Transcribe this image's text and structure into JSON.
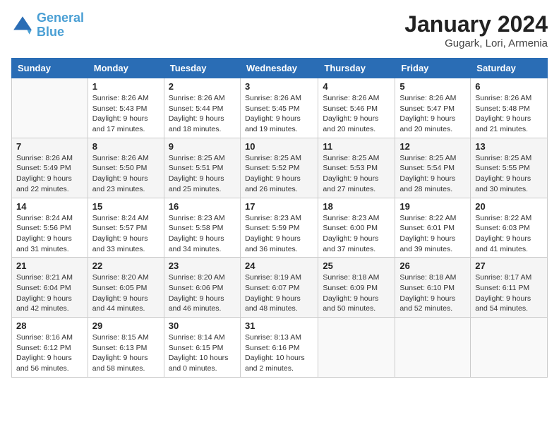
{
  "header": {
    "logo_general": "General",
    "logo_blue": "Blue",
    "month_year": "January 2024",
    "location": "Gugark, Lori, Armenia"
  },
  "days_of_week": [
    "Sunday",
    "Monday",
    "Tuesday",
    "Wednesday",
    "Thursday",
    "Friday",
    "Saturday"
  ],
  "weeks": [
    [
      {
        "day": "",
        "sunrise": "",
        "sunset": "",
        "daylight": ""
      },
      {
        "day": "1",
        "sunrise": "Sunrise: 8:26 AM",
        "sunset": "Sunset: 5:43 PM",
        "daylight": "Daylight: 9 hours and 17 minutes."
      },
      {
        "day": "2",
        "sunrise": "Sunrise: 8:26 AM",
        "sunset": "Sunset: 5:44 PM",
        "daylight": "Daylight: 9 hours and 18 minutes."
      },
      {
        "day": "3",
        "sunrise": "Sunrise: 8:26 AM",
        "sunset": "Sunset: 5:45 PM",
        "daylight": "Daylight: 9 hours and 19 minutes."
      },
      {
        "day": "4",
        "sunrise": "Sunrise: 8:26 AM",
        "sunset": "Sunset: 5:46 PM",
        "daylight": "Daylight: 9 hours and 20 minutes."
      },
      {
        "day": "5",
        "sunrise": "Sunrise: 8:26 AM",
        "sunset": "Sunset: 5:47 PM",
        "daylight": "Daylight: 9 hours and 20 minutes."
      },
      {
        "day": "6",
        "sunrise": "Sunrise: 8:26 AM",
        "sunset": "Sunset: 5:48 PM",
        "daylight": "Daylight: 9 hours and 21 minutes."
      }
    ],
    [
      {
        "day": "7",
        "sunrise": "Sunrise: 8:26 AM",
        "sunset": "Sunset: 5:49 PM",
        "daylight": "Daylight: 9 hours and 22 minutes."
      },
      {
        "day": "8",
        "sunrise": "Sunrise: 8:26 AM",
        "sunset": "Sunset: 5:50 PM",
        "daylight": "Daylight: 9 hours and 23 minutes."
      },
      {
        "day": "9",
        "sunrise": "Sunrise: 8:25 AM",
        "sunset": "Sunset: 5:51 PM",
        "daylight": "Daylight: 9 hours and 25 minutes."
      },
      {
        "day": "10",
        "sunrise": "Sunrise: 8:25 AM",
        "sunset": "Sunset: 5:52 PM",
        "daylight": "Daylight: 9 hours and 26 minutes."
      },
      {
        "day": "11",
        "sunrise": "Sunrise: 8:25 AM",
        "sunset": "Sunset: 5:53 PM",
        "daylight": "Daylight: 9 hours and 27 minutes."
      },
      {
        "day": "12",
        "sunrise": "Sunrise: 8:25 AM",
        "sunset": "Sunset: 5:54 PM",
        "daylight": "Daylight: 9 hours and 28 minutes."
      },
      {
        "day": "13",
        "sunrise": "Sunrise: 8:25 AM",
        "sunset": "Sunset: 5:55 PM",
        "daylight": "Daylight: 9 hours and 30 minutes."
      }
    ],
    [
      {
        "day": "14",
        "sunrise": "Sunrise: 8:24 AM",
        "sunset": "Sunset: 5:56 PM",
        "daylight": "Daylight: 9 hours and 31 minutes."
      },
      {
        "day": "15",
        "sunrise": "Sunrise: 8:24 AM",
        "sunset": "Sunset: 5:57 PM",
        "daylight": "Daylight: 9 hours and 33 minutes."
      },
      {
        "day": "16",
        "sunrise": "Sunrise: 8:23 AM",
        "sunset": "Sunset: 5:58 PM",
        "daylight": "Daylight: 9 hours and 34 minutes."
      },
      {
        "day": "17",
        "sunrise": "Sunrise: 8:23 AM",
        "sunset": "Sunset: 5:59 PM",
        "daylight": "Daylight: 9 hours and 36 minutes."
      },
      {
        "day": "18",
        "sunrise": "Sunrise: 8:23 AM",
        "sunset": "Sunset: 6:00 PM",
        "daylight": "Daylight: 9 hours and 37 minutes."
      },
      {
        "day": "19",
        "sunrise": "Sunrise: 8:22 AM",
        "sunset": "Sunset: 6:01 PM",
        "daylight": "Daylight: 9 hours and 39 minutes."
      },
      {
        "day": "20",
        "sunrise": "Sunrise: 8:22 AM",
        "sunset": "Sunset: 6:03 PM",
        "daylight": "Daylight: 9 hours and 41 minutes."
      }
    ],
    [
      {
        "day": "21",
        "sunrise": "Sunrise: 8:21 AM",
        "sunset": "Sunset: 6:04 PM",
        "daylight": "Daylight: 9 hours and 42 minutes."
      },
      {
        "day": "22",
        "sunrise": "Sunrise: 8:20 AM",
        "sunset": "Sunset: 6:05 PM",
        "daylight": "Daylight: 9 hours and 44 minutes."
      },
      {
        "day": "23",
        "sunrise": "Sunrise: 8:20 AM",
        "sunset": "Sunset: 6:06 PM",
        "daylight": "Daylight: 9 hours and 46 minutes."
      },
      {
        "day": "24",
        "sunrise": "Sunrise: 8:19 AM",
        "sunset": "Sunset: 6:07 PM",
        "daylight": "Daylight: 9 hours and 48 minutes."
      },
      {
        "day": "25",
        "sunrise": "Sunrise: 8:18 AM",
        "sunset": "Sunset: 6:09 PM",
        "daylight": "Daylight: 9 hours and 50 minutes."
      },
      {
        "day": "26",
        "sunrise": "Sunrise: 8:18 AM",
        "sunset": "Sunset: 6:10 PM",
        "daylight": "Daylight: 9 hours and 52 minutes."
      },
      {
        "day": "27",
        "sunrise": "Sunrise: 8:17 AM",
        "sunset": "Sunset: 6:11 PM",
        "daylight": "Daylight: 9 hours and 54 minutes."
      }
    ],
    [
      {
        "day": "28",
        "sunrise": "Sunrise: 8:16 AM",
        "sunset": "Sunset: 6:12 PM",
        "daylight": "Daylight: 9 hours and 56 minutes."
      },
      {
        "day": "29",
        "sunrise": "Sunrise: 8:15 AM",
        "sunset": "Sunset: 6:13 PM",
        "daylight": "Daylight: 9 hours and 58 minutes."
      },
      {
        "day": "30",
        "sunrise": "Sunrise: 8:14 AM",
        "sunset": "Sunset: 6:15 PM",
        "daylight": "Daylight: 10 hours and 0 minutes."
      },
      {
        "day": "31",
        "sunrise": "Sunrise: 8:13 AM",
        "sunset": "Sunset: 6:16 PM",
        "daylight": "Daylight: 10 hours and 2 minutes."
      },
      {
        "day": "",
        "sunrise": "",
        "sunset": "",
        "daylight": ""
      },
      {
        "day": "",
        "sunrise": "",
        "sunset": "",
        "daylight": ""
      },
      {
        "day": "",
        "sunrise": "",
        "sunset": "",
        "daylight": ""
      }
    ]
  ]
}
